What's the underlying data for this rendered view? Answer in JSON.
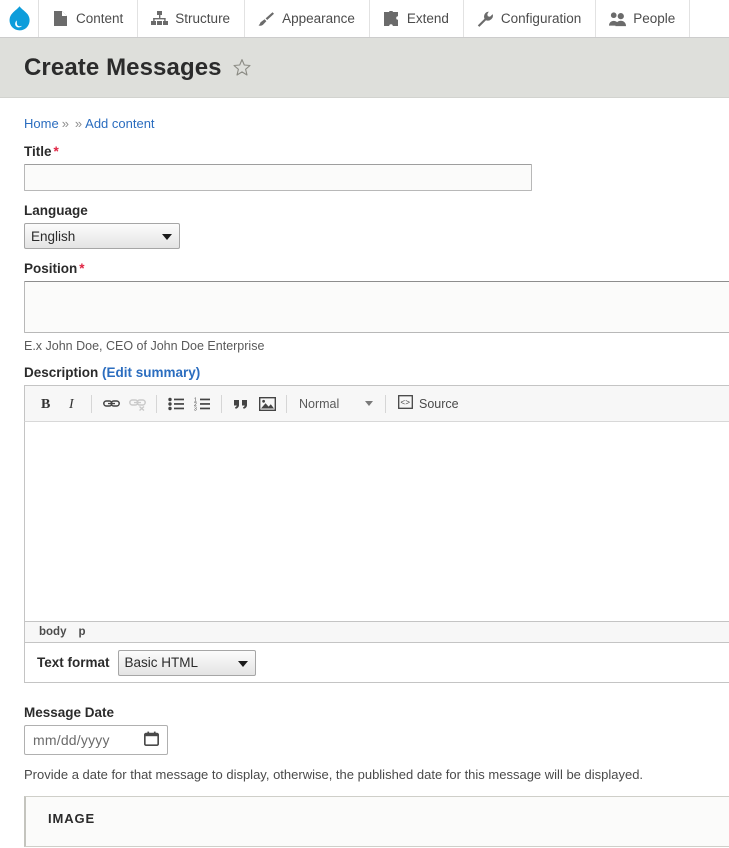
{
  "toolbar": {
    "logo_name": "drupal-drop-logo",
    "logo_color": "#0d9ddb",
    "items": [
      {
        "label": "Content",
        "icon": "page-icon"
      },
      {
        "label": "Structure",
        "icon": "sitemap-icon"
      },
      {
        "label": "Appearance",
        "icon": "paintbrush-icon"
      },
      {
        "label": "Extend",
        "icon": "puzzle-piece-icon"
      },
      {
        "label": "Configuration",
        "icon": "wrench-icon"
      },
      {
        "label": "People",
        "icon": "people-icon"
      }
    ]
  },
  "header": {
    "title": "Create Messages",
    "star_icon": "star-outline-icon",
    "band_color": "#dedfdb"
  },
  "breadcrumb": {
    "items": [
      "Home",
      "",
      "Add content"
    ],
    "separator": "»"
  },
  "form": {
    "title_field": {
      "label": "Title",
      "required_marker": "*",
      "value": "",
      "placeholder": ""
    },
    "language_field": {
      "label": "Language",
      "value": "English",
      "options": [
        "English"
      ]
    },
    "position_field": {
      "label": "Position",
      "required_marker": "*",
      "value": "",
      "description": "E.x John Doe, CEO of John Doe Enterprise"
    },
    "description_field": {
      "label": "Description",
      "summary_link": "(Edit summary)",
      "editor": {
        "buttons": [
          {
            "name": "bold-icon",
            "label": "B"
          },
          {
            "name": "italic-icon",
            "label": "I"
          },
          {
            "name": "link-icon",
            "label": "Link"
          },
          {
            "name": "unlink-icon",
            "label": "Unlink",
            "disabled": true
          },
          {
            "name": "bulleted-list-icon",
            "label": "Bulleted list"
          },
          {
            "name": "numbered-list-icon",
            "label": "Numbered list"
          },
          {
            "name": "blockquote-icon",
            "label": "Block quote"
          },
          {
            "name": "image-icon",
            "label": "Image"
          }
        ],
        "paragraph_format": "Normal",
        "source_label": "Source",
        "content": "",
        "elements_path": [
          "body",
          "p"
        ]
      },
      "text_format": {
        "label": "Text format",
        "value": "Basic HTML",
        "options": [
          "Basic HTML"
        ]
      }
    },
    "message_date_field": {
      "label": "Message Date",
      "placeholder": "mm/dd/yyyy",
      "value": "",
      "calendar_icon": "calendar-icon",
      "help": "Provide a date for that message to display, otherwise, the published date for this message will be displayed."
    },
    "image_fieldset": {
      "legend": "IMAGE"
    }
  },
  "colors": {
    "link": "#2b6dbf",
    "required": "#e02443",
    "band": "#dedfdb"
  }
}
